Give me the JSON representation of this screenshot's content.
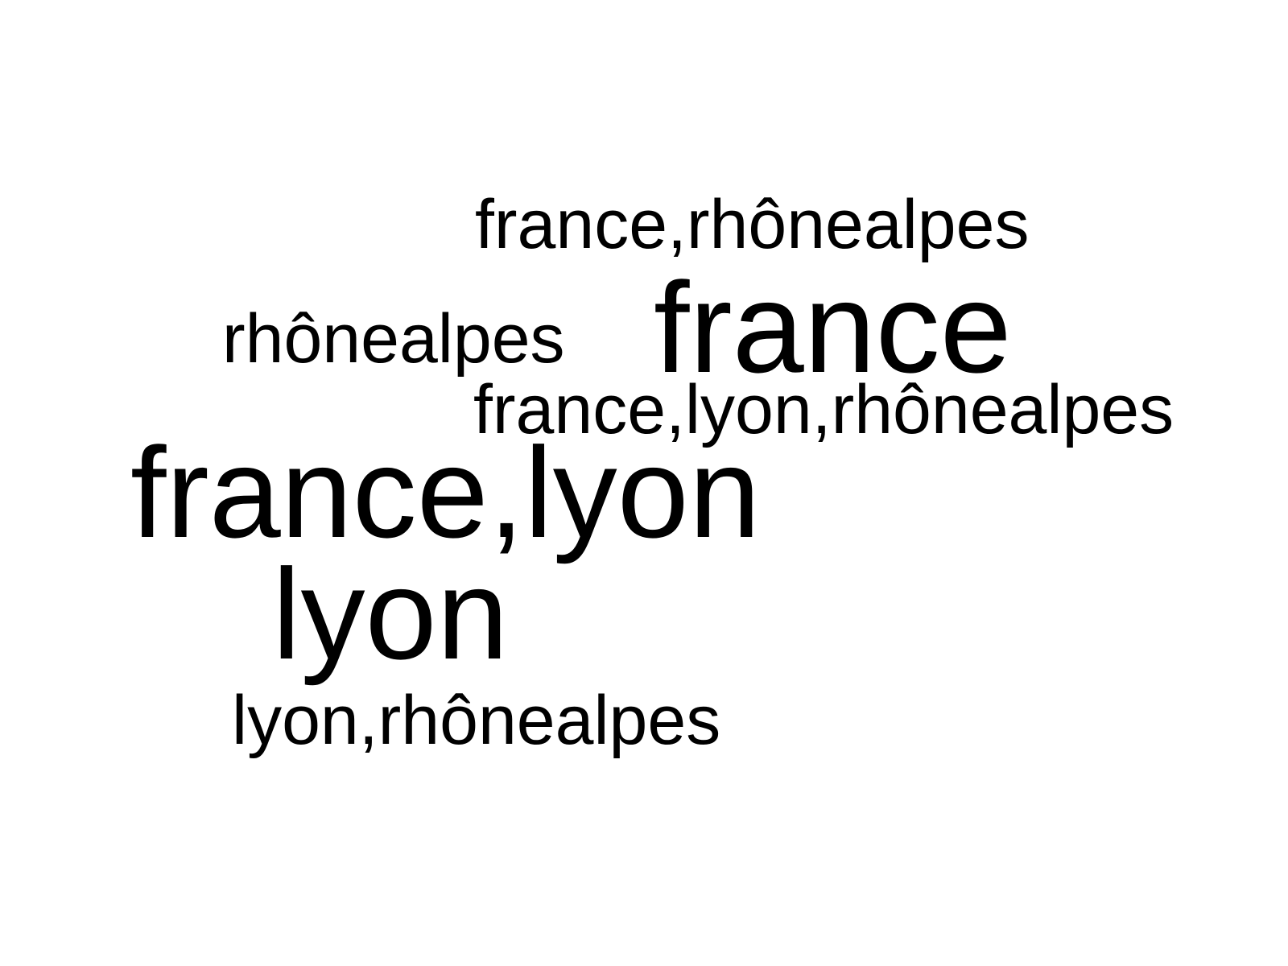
{
  "word_cloud": {
    "words": [
      {
        "text": "france,rhônealpes"
      },
      {
        "text": "rhônealpes"
      },
      {
        "text": "france"
      },
      {
        "text": "france,lyon,rhônealpes"
      },
      {
        "text": "france,lyon"
      },
      {
        "text": "lyon"
      },
      {
        "text": "lyon,rhônealpes"
      }
    ]
  }
}
